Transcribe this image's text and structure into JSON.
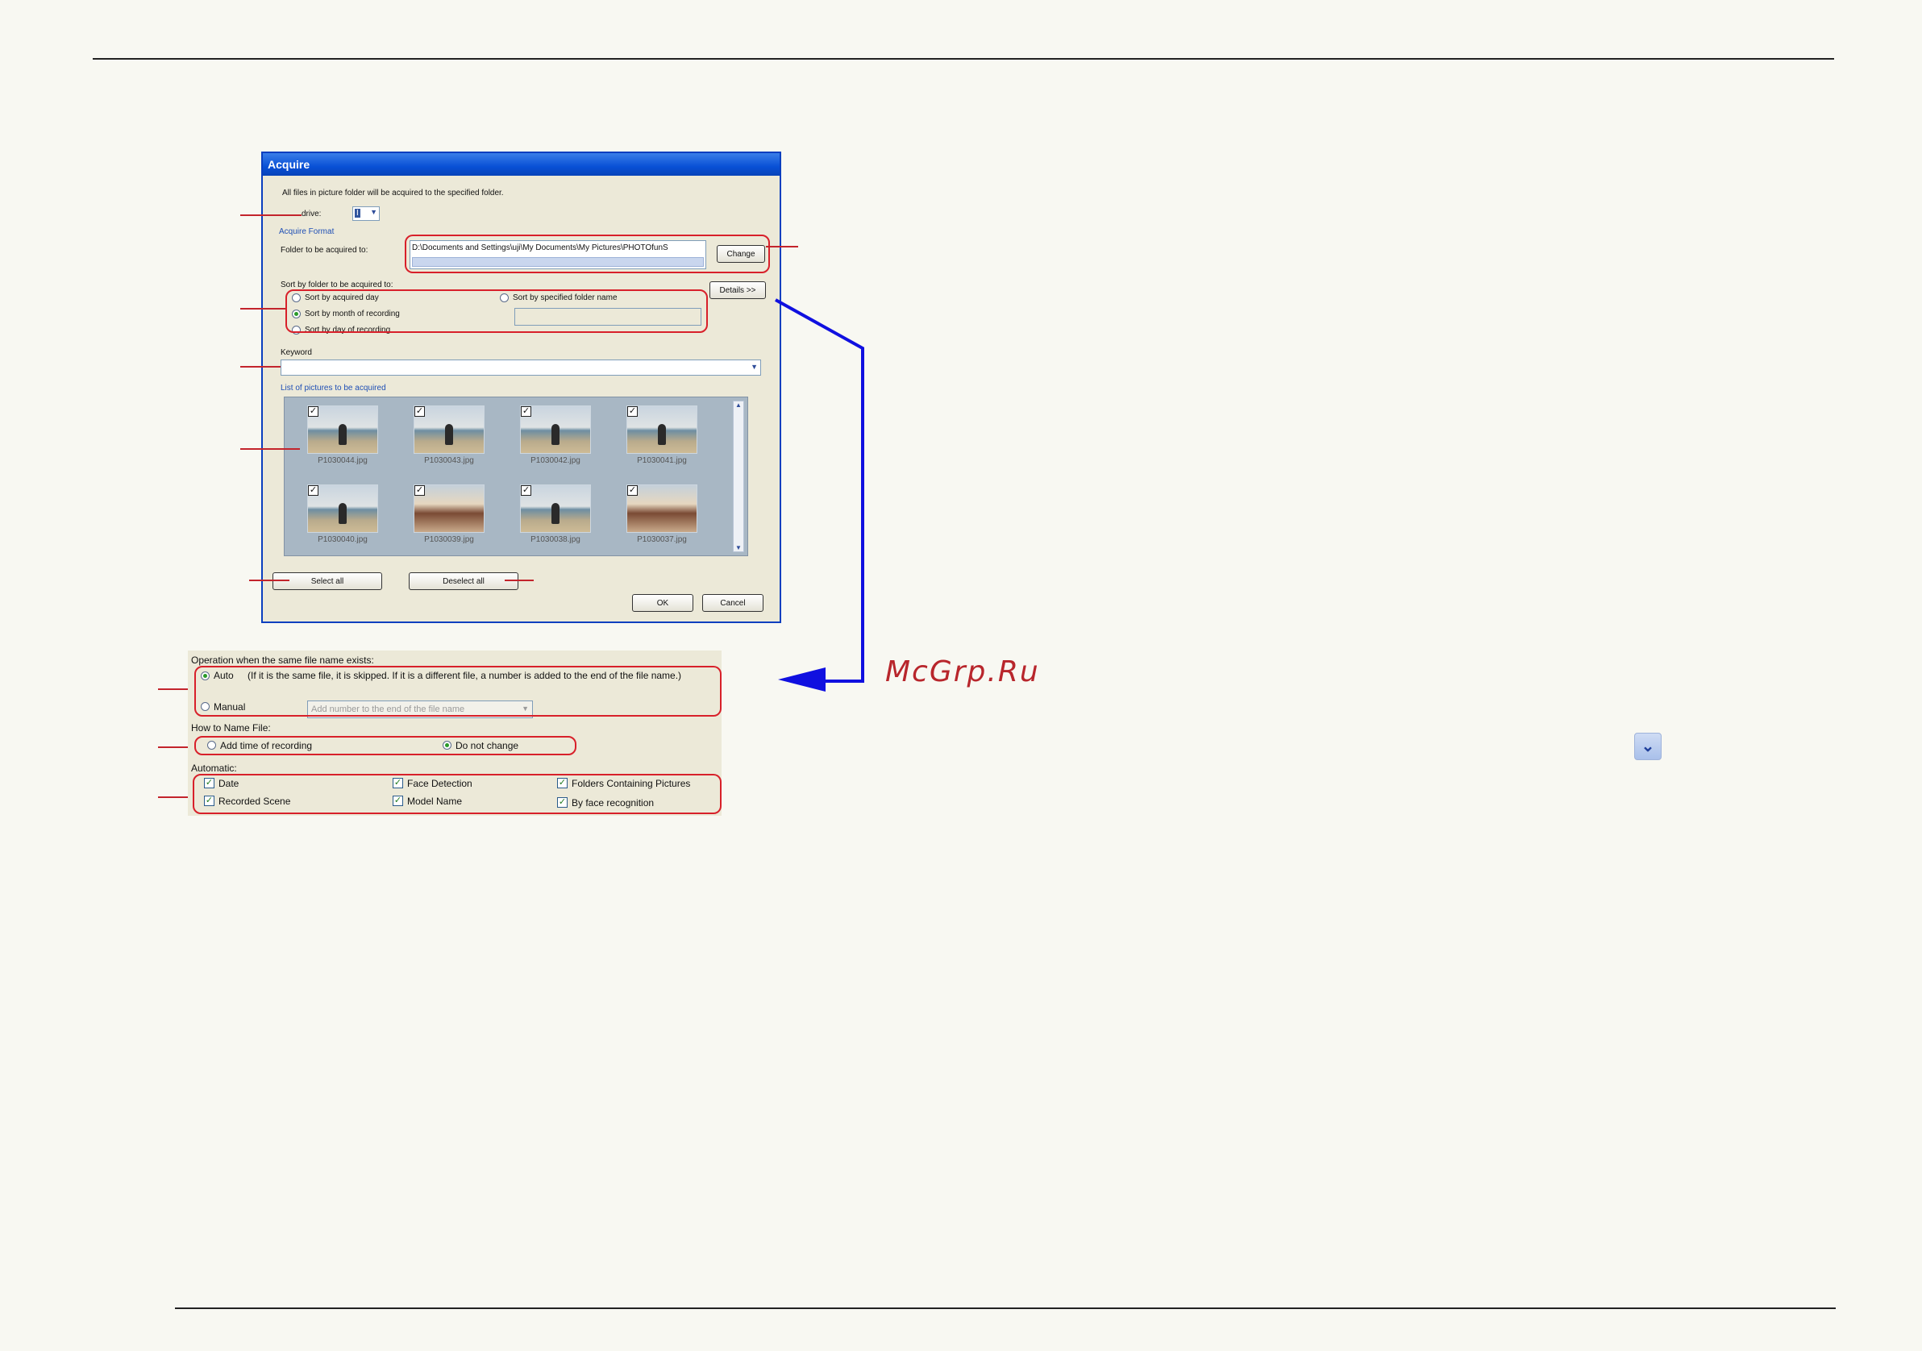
{
  "dialog": {
    "title": "Acquire",
    "info": "All files in picture folder will be acquired to the specified folder.",
    "drive_label": "drive:",
    "drive_value": "I",
    "acquire_format_label": "Acquire Format",
    "folder_label": "Folder to be acquired to:",
    "folder_path": "D:\\Documents and Settings\\uji\\My Documents\\My Pictures\\PHOTOfunS",
    "change_button": "Change",
    "details_button": "Details >>",
    "sort_label": "Sort by folder to be acquired to:",
    "sort_options": [
      "Sort by acquired day",
      "Sort by month of recording",
      "Sort by day of recording"
    ],
    "sort_selected_index": 1,
    "sort_specified": "Sort by specified folder name",
    "keyword_label": "Keyword",
    "list_label": "List of pictures to be acquired",
    "pictures": [
      "P1030044.jpg",
      "P1030043.jpg",
      "P1030042.jpg",
      "P1030041.jpg",
      "P1030040.jpg",
      "P1030039.jpg",
      "P1030038.jpg",
      "P1030037.jpg"
    ],
    "select_all": "Select all",
    "deselect_all": "Deselect all",
    "ok": "OK",
    "cancel": "Cancel"
  },
  "details_panel": {
    "operation_label": "Operation when the same file name exists:",
    "auto_label": "Auto",
    "auto_desc": "(If it is the same file, it is skipped. If it is a different file, a number is added to the end of the file name.)",
    "manual_label": "Manual",
    "manual_select": "Add number to the end of the file name",
    "name_file_label": "How to Name File:",
    "name_option_1": "Add time of recording",
    "name_option_2": "Do not change",
    "automatic_label": "Automatic:",
    "auto_checks": [
      "Date",
      "Face Detection",
      "Folders Containing Pictures",
      "Recorded Scene",
      "Model Name",
      "By face recognition"
    ]
  },
  "watermark": "McGrp.Ru",
  "colors": {
    "highlight": "#d8202a",
    "arrow": "#1010e0",
    "titlebar": "#0850d6"
  },
  "icons": {
    "dropdown": "chevron-down-icon"
  }
}
